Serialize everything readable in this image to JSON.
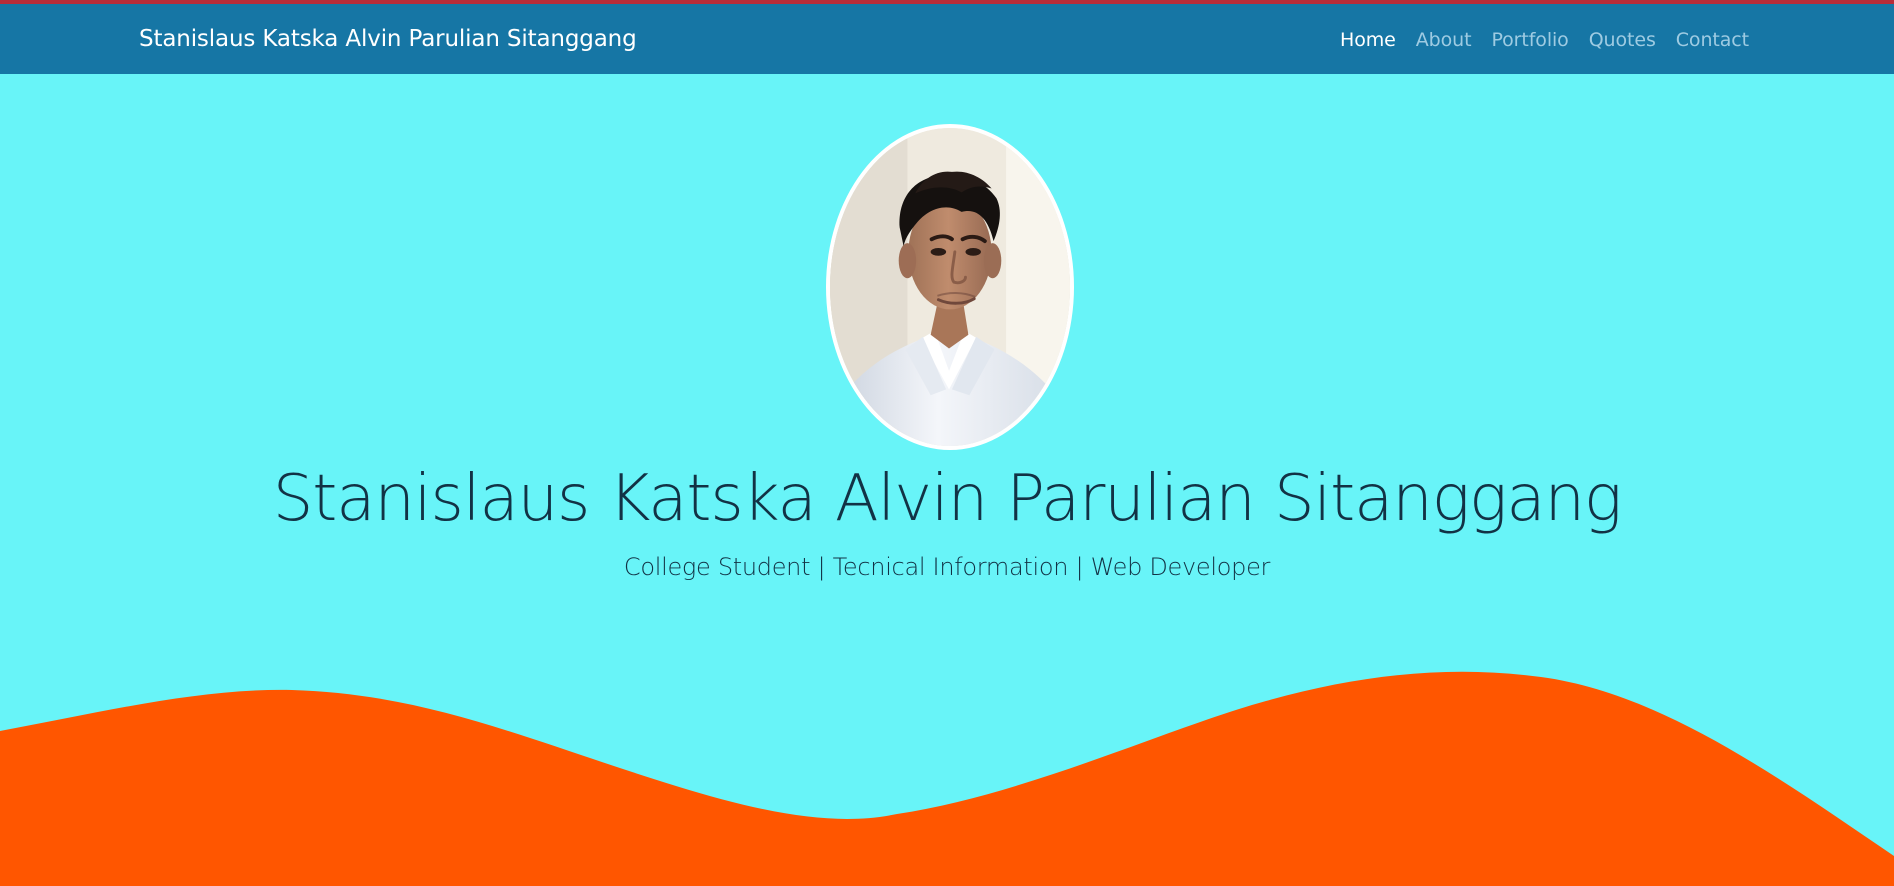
{
  "header": {
    "brand": "Stanislaus Katska Alvin Parulian Sitanggang",
    "nav_items": [
      {
        "label": "Home",
        "active": true
      },
      {
        "label": "About",
        "active": false
      },
      {
        "label": "Portfolio",
        "active": false
      },
      {
        "label": "Quotes",
        "active": false
      },
      {
        "label": "Contact",
        "active": false
      }
    ]
  },
  "hero": {
    "name": "Stanislaus Katska Alvin Parulian Sitanggang",
    "subtitle": "College Student | Tecnical Information | Web Developer",
    "avatar": "profile-photo"
  },
  "colors": {
    "top_line": "#b82d3a",
    "navbar": "#1676a5",
    "background": "#68f4f8",
    "wave": "#ff5600",
    "text": "#123245",
    "nav_inactive": "#9ecbe2",
    "nav_active": "#ffffff"
  }
}
